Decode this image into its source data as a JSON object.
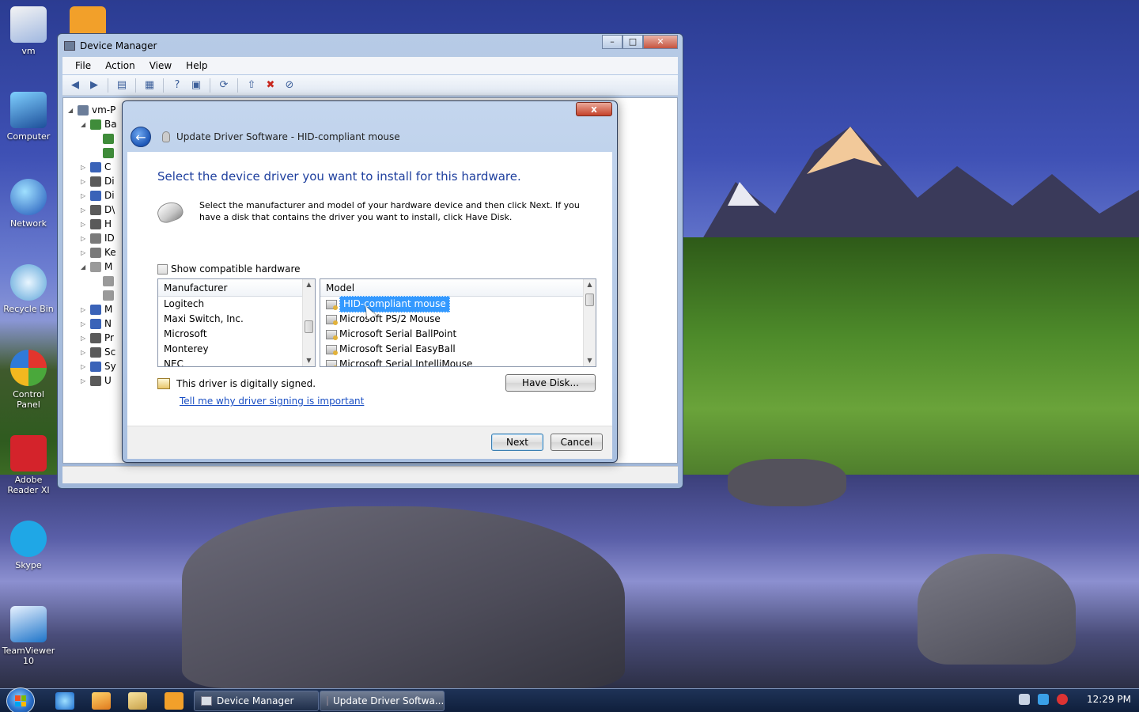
{
  "desktop": {
    "icons": [
      {
        "label": "vm",
        "color": "#d9d9d9"
      },
      {
        "label": "",
        "color": "#f2a02a"
      },
      {
        "label": "Computer",
        "color": "#4aa0d8"
      },
      {
        "label": "Network",
        "color": "#3a77d0"
      },
      {
        "label": "Recycle Bin",
        "color": "#9ed0f0"
      },
      {
        "label": "Control Panel",
        "color": "#4d8fd6"
      },
      {
        "label": "Adobe Reader XI",
        "color": "#d4232b"
      },
      {
        "label": "Skype",
        "color": "#1fa7e6"
      },
      {
        "label": "TeamViewer 10",
        "color": "#1e74c9"
      }
    ]
  },
  "device_manager": {
    "title": "Device Manager",
    "menu": [
      "File",
      "Action",
      "View",
      "Help"
    ],
    "tree": [
      {
        "label": "vm-P",
        "arrow": "◢",
        "color": "#6b7d99"
      },
      {
        "label": "Ba",
        "arrow": "◢",
        "color": "#3f8c3a"
      },
      {
        "label": "",
        "arrow": "",
        "color": "#3f8c3a"
      },
      {
        "label": "",
        "arrow": "",
        "color": "#3f8c3a"
      },
      {
        "label": "C",
        "arrow": "▷",
        "color": "#3a63b8"
      },
      {
        "label": "Di",
        "arrow": "▷",
        "color": "#5a5a5a"
      },
      {
        "label": "Di",
        "arrow": "▷",
        "color": "#3a63b8"
      },
      {
        "label": "D\\",
        "arrow": "▷",
        "color": "#5a5a5a"
      },
      {
        "label": "H",
        "arrow": "▷",
        "color": "#5a5a5a"
      },
      {
        "label": "ID",
        "arrow": "▷",
        "color": "#7a7a7a"
      },
      {
        "label": "Ke",
        "arrow": "▷",
        "color": "#7a7a7a"
      },
      {
        "label": "M",
        "arrow": "◢",
        "color": "#9a9a9a"
      },
      {
        "label": "",
        "arrow": "",
        "color": "#9a9a9a"
      },
      {
        "label": "",
        "arrow": "",
        "color": "#9a9a9a"
      },
      {
        "label": "M",
        "arrow": "▷",
        "color": "#3a63b8"
      },
      {
        "label": "N",
        "arrow": "▷",
        "color": "#3a63b8"
      },
      {
        "label": "Pr",
        "arrow": "▷",
        "color": "#5a5a5a"
      },
      {
        "label": "Sc",
        "arrow": "▷",
        "color": "#5a5a5a"
      },
      {
        "label": "Sy",
        "arrow": "▷",
        "color": "#3a63b8"
      },
      {
        "label": "U",
        "arrow": "▷",
        "color": "#5a5a5a"
      }
    ]
  },
  "dialog": {
    "title": "Update Driver Software - HID-compliant mouse",
    "heading": "Select the device driver you want to install for this hardware.",
    "description": "Select the manufacturer and model of your hardware device and then click Next. If you have a disk that contains the driver you want to install, click Have Disk.",
    "show_compatible": "Show compatible hardware",
    "manufacturer_header": "Manufacturer",
    "manufacturers": [
      "Logitech",
      "Maxi Switch, Inc.",
      "Microsoft",
      "Monterey",
      "NEC"
    ],
    "model_header": "Model",
    "models": [
      "HID-compliant mouse",
      "Microsoft PS/2 Mouse",
      "Microsoft Serial BallPoint",
      "Microsoft Serial EasyBall",
      "Microsoft Serial IntelliMouse"
    ],
    "signed_text": "This driver is digitally signed.",
    "signing_link": "Tell me why driver signing is important",
    "have_disk": "Have Disk...",
    "next": "Next",
    "cancel": "Cancel",
    "close": "x"
  },
  "taskbar": {
    "tasks": [
      "Device Manager",
      "Update Driver Softwa..."
    ],
    "clock": "12:29 PM"
  }
}
